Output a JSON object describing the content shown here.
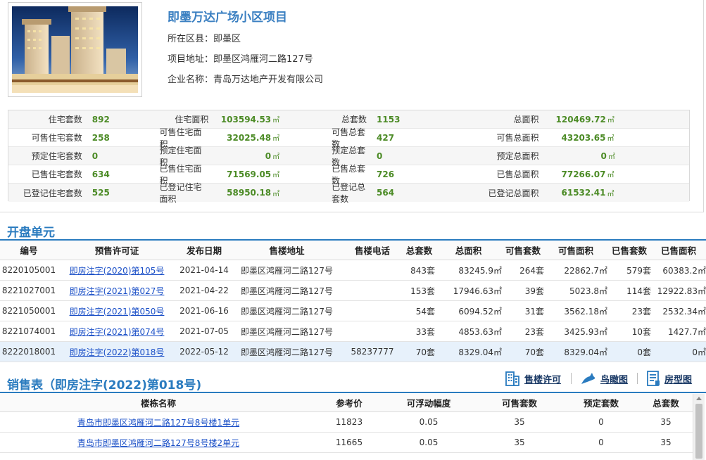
{
  "project": {
    "title": "即墨万达广场小区项目",
    "district_label": "所在区县：",
    "district": "即墨区",
    "address_label": "项目地址：",
    "address": "即墨区鸿雁河二路127号",
    "company_label": "企业名称：",
    "company": "青岛万达地产开发有限公司",
    "photo_icon": "building-photo"
  },
  "stats": {
    "unit": "㎡",
    "rows": [
      {
        "a_label": "住宅套数",
        "a_val": "892",
        "b_label": "住宅面积",
        "b_val": "103594.53",
        "c_label": "总套数",
        "c_val": "1153",
        "d_label": "总面积",
        "d_val": "120469.72"
      },
      {
        "a_label": "可售住宅套数",
        "a_val": "258",
        "b_label": "可售住宅面积",
        "b_val": "32025.48",
        "c_label": "可售总套数",
        "c_val": "427",
        "d_label": "可售总面积",
        "d_val": "43203.65"
      },
      {
        "a_label": "预定住宅套数",
        "a_val": "0",
        "b_label": "预定住宅面积",
        "b_val": "0",
        "c_label": "预定总套数",
        "c_val": "0",
        "d_label": "预定总面积",
        "d_val": "0"
      },
      {
        "a_label": "已售住宅套数",
        "a_val": "634",
        "b_label": "已售住宅面积",
        "b_val": "71569.05",
        "c_label": "已售总套数",
        "c_val": "726",
        "d_label": "已售总面积",
        "d_val": "77266.07"
      },
      {
        "a_label": "已登记住宅套数",
        "a_val": "525",
        "b_label": "已登记住宅面积",
        "b_val": "58950.18",
        "c_label": "已登记总套数",
        "c_val": "564",
        "d_label": "已登记总面积",
        "d_val": "61532.41"
      }
    ]
  },
  "units_section": {
    "title": "开盘单元",
    "headers": [
      "编号",
      "预售许可证",
      "发布日期",
      "售楼地址",
      "售楼电话",
      "总套数",
      "总面积",
      "可售套数",
      "可售面积",
      "已售套数",
      "已售面积"
    ],
    "rows": [
      [
        "8220105001",
        "即房注字(2020)第105号",
        "2021-04-14",
        "即墨区鸿雁河二路127号",
        "",
        "843套",
        "83245.9㎡",
        "264套",
        "22862.7㎡",
        "579套",
        "60383.2㎡"
      ],
      [
        "8221027001",
        "即房注字(2021)第027号",
        "2021-04-22",
        "即墨区鸿雁河二路127号",
        "",
        "153套",
        "17946.63㎡",
        "39套",
        "5023.8㎡",
        "114套",
        "12922.83㎡"
      ],
      [
        "8221050001",
        "即房注字(2021)第050号",
        "2021-06-16",
        "即墨区鸿雁河二路127号",
        "",
        "54套",
        "6094.52㎡",
        "31套",
        "3562.18㎡",
        "23套",
        "2532.34㎡"
      ],
      [
        "8221074001",
        "即房注字(2021)第074号",
        "2021-07-05",
        "即墨区鸿雁河二路127号",
        "",
        "33套",
        "4853.63㎡",
        "23套",
        "3425.93㎡",
        "10套",
        "1427.7㎡"
      ],
      [
        "8222018001",
        "即房注字(2022)第018号",
        "2022-05-12",
        "即墨区鸿雁河二路127号",
        "58237777",
        "70套",
        "8329.04㎡",
        "70套",
        "8329.04㎡",
        "0套",
        "0㎡"
      ]
    ],
    "highlight_row": 4
  },
  "sales_section": {
    "title": "销售表（即房注字(2022)第018号)",
    "toolbar": {
      "permit_label": "售楼许可",
      "birdview_label": "鸟瞰图",
      "floorplan_label": "房型图"
    },
    "headers": [
      "楼栋名称",
      "参考价",
      "可浮动幅度",
      "可售套数",
      "预定套数",
      "总套数"
    ],
    "rows": [
      [
        "青岛市即墨区鸿雁河二路127号8号楼1单元",
        "11823",
        "0.05",
        "35",
        "0",
        "35"
      ],
      [
        "青岛市即墨区鸿雁河二路127号8号楼2单元",
        "11665",
        "0.05",
        "35",
        "0",
        "35"
      ]
    ]
  },
  "colors": {
    "accent": "#2a7bbf",
    "value_green": "#4c8b26",
    "link_blue": "#1a4fc7",
    "highlight_row": "#e7f1fb"
  }
}
